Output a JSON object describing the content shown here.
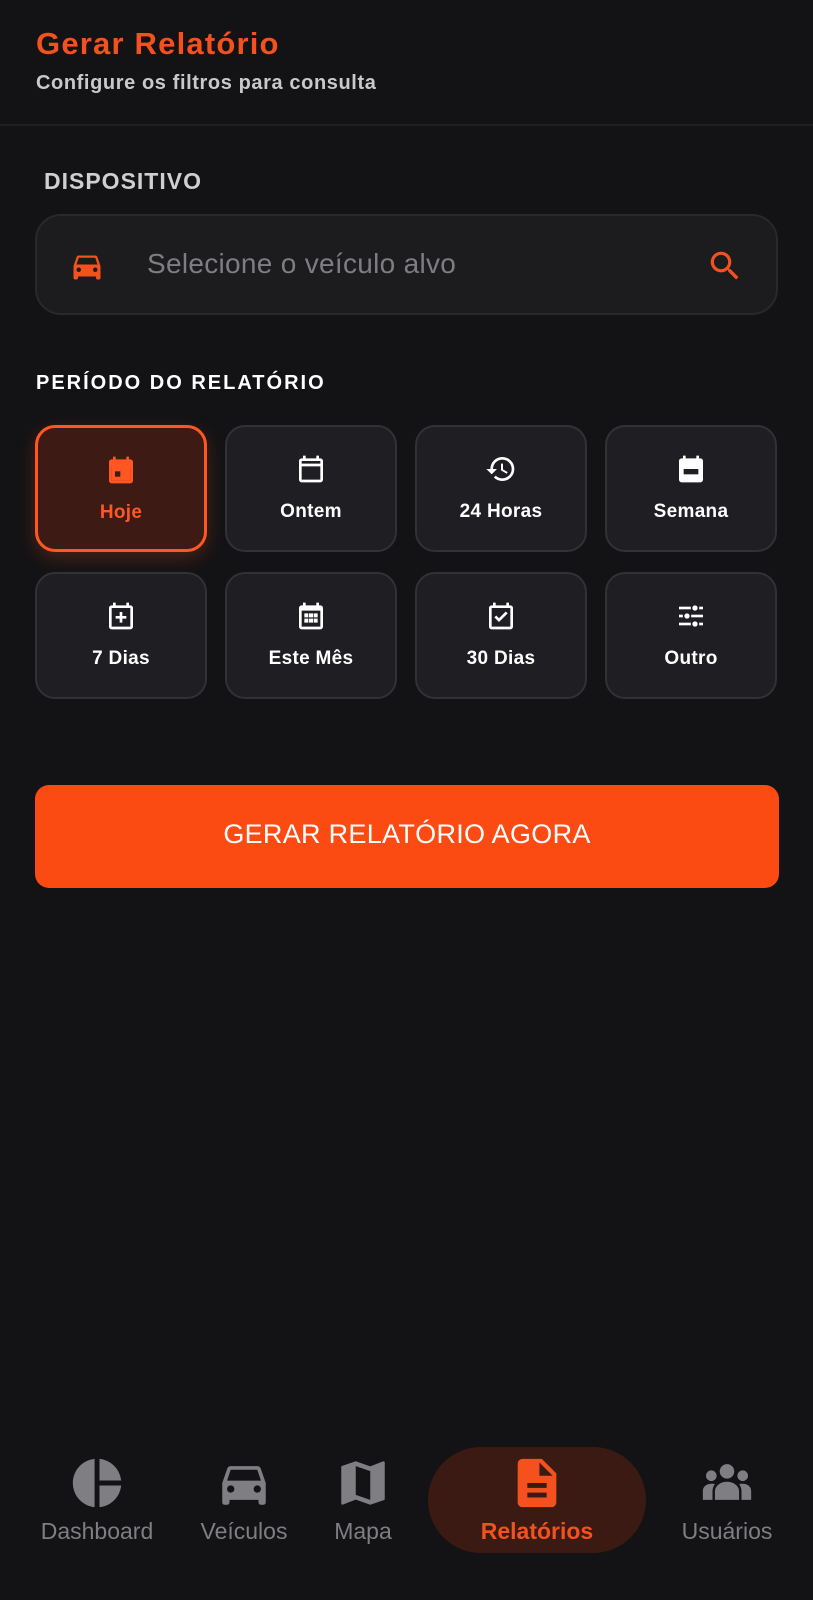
{
  "header": {
    "title": "Gerar Relatório",
    "subtitle": "Configure os filtros para consulta"
  },
  "device": {
    "label": "DISPOSITIVO",
    "placeholder": "Selecione o veículo alvo",
    "icon": "car-icon",
    "action_icon": "search-icon"
  },
  "period": {
    "label": "PERÍODO DO RELATÓRIO",
    "options": [
      {
        "label": "Hoje",
        "icon": "calendar-today-icon",
        "selected": true
      },
      {
        "label": "Ontem",
        "icon": "calendar-outline-icon",
        "selected": false
      },
      {
        "label": "24 Horas",
        "icon": "history-icon",
        "selected": false
      },
      {
        "label": "Semana",
        "icon": "calendar-week-icon",
        "selected": false
      },
      {
        "label": "7 Dias",
        "icon": "calendar-plus-icon",
        "selected": false
      },
      {
        "label": "Este Mês",
        "icon": "calendar-month-icon",
        "selected": false
      },
      {
        "label": "30 Dias",
        "icon": "calendar-check-icon",
        "selected": false
      },
      {
        "label": "Outro",
        "icon": "sliders-icon",
        "selected": false
      }
    ]
  },
  "generate_button": "GERAR RELATÓRIO AGORA",
  "nav": {
    "items": [
      {
        "label": "Dashboard",
        "icon": "pie-chart-icon",
        "active": false
      },
      {
        "label": "Veículos",
        "icon": "car-icon",
        "active": false
      },
      {
        "label": "Mapa",
        "icon": "map-icon",
        "active": false
      },
      {
        "label": "Relatórios",
        "icon": "document-icon",
        "active": true
      },
      {
        "label": "Usuários",
        "icon": "users-icon",
        "active": false
      }
    ]
  },
  "colors": {
    "accent": "#f4511e",
    "background": "#131315",
    "card": "#1e1e23",
    "muted_text": "#7e7e83"
  }
}
